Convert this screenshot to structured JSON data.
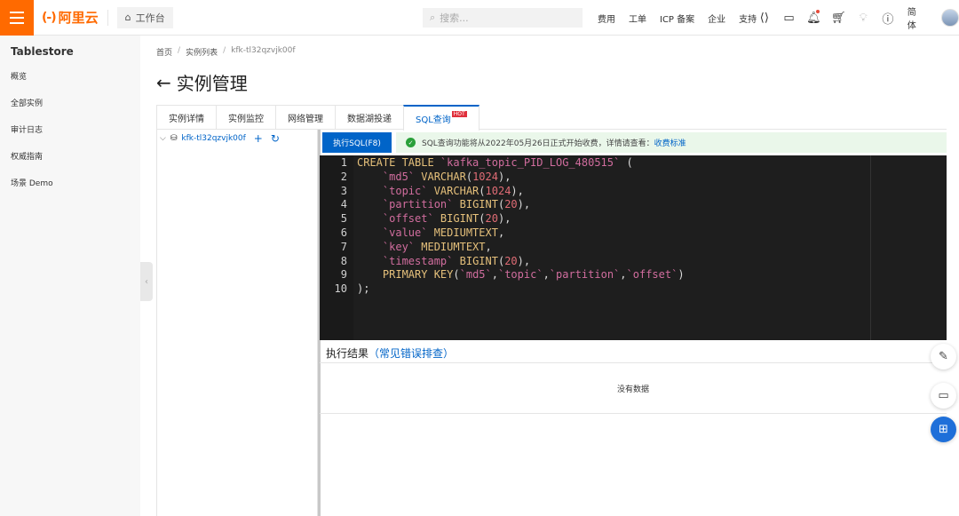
{
  "topbar": {
    "logo_mark": "(-)",
    "logo_text": "阿里云",
    "workbench_label": "工作台",
    "search_placeholder": "搜索...",
    "links": [
      "费用",
      "工单",
      "ICP 备案",
      "企业",
      "支持"
    ],
    "lang": "简体"
  },
  "sidebar": {
    "title": "Tablestore",
    "items": [
      "概览",
      "全部实例",
      "审计日志",
      "权威指南",
      "场景 Demo"
    ]
  },
  "breadcrumb": [
    "首页",
    "实例列表",
    "kfk-tl32qzvjk00f"
  ],
  "page_title": "实例管理",
  "tabs": [
    "实例详情",
    "实例监控",
    "网络管理",
    "数据湖投递",
    "SQL查询"
  ],
  "tab_badge": "HOT",
  "tree": {
    "instance": "kfk-tl32qzvjk00f"
  },
  "toolbar": {
    "exec_label": "执行SQL(F8)",
    "notice_text": "SQL查询功能将从2022年05月26日正式开始收费，详情请查看：",
    "notice_link": "收费标准"
  },
  "editor": {
    "line_numbers": [
      "1",
      "2",
      "3",
      "4",
      "5",
      "6",
      "7",
      "8",
      "9",
      "10"
    ]
  },
  "results": {
    "title": "执行结果",
    "help_link": "（常见错误排查）",
    "empty_text": "没有数据"
  },
  "colors": {
    "brand": "#ff6a00",
    "accent": "#0064c8",
    "editor_bg": "#1e1e1e"
  }
}
